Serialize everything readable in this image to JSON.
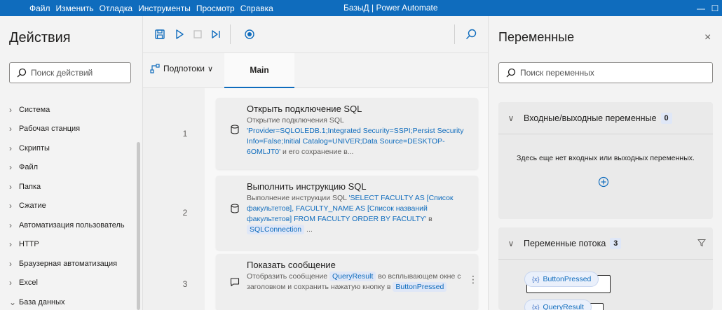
{
  "menu": {
    "items": [
      "Файл",
      "Изменить",
      "Отладка",
      "Инструменты",
      "Просмотр",
      "Справка"
    ],
    "window_title": "БазыД | Power Automate"
  },
  "actions_panel": {
    "title": "Действия",
    "search_placeholder": "Поиск действий",
    "categories": [
      "Система",
      "Рабочая станция",
      "Скрипты",
      "Файл",
      "Папка",
      "Сжатие",
      "Автоматизация пользователь",
      "HTTP",
      "Браузерная автоматизация",
      "Excel",
      "База данных"
    ]
  },
  "canvas": {
    "subflows_label": "Подпотоки",
    "main_tab": "Main",
    "steps": [
      {
        "number": "1",
        "title": "Открыть подключение SQL",
        "desc_prefix": "Открытие подключения SQL",
        "desc_link": "'Provider=SQLOLEDB.1;Integrated Security=SSPI;Persist Security Info=False;Initial Catalog=UNIVER;Data Source=DESKTOP-6OMLJT0'",
        "desc_suffix": " и его сохранение в..."
      },
      {
        "number": "2",
        "title": "Выполнить инструкцию SQL",
        "desc_prefix": "Выполнение инструкции SQL ",
        "desc_link": "'SELECT FACULTY AS [Список факультетов], FACULTY_NAME AS [Список названий факультетов] FROM FACULTY ORDER BY FACULTY'",
        "desc_mid": " в ",
        "desc_pill": "SQLConnection",
        "desc_suffix": " ..."
      },
      {
        "number": "3",
        "title": "Показать сообщение",
        "desc_prefix": "Отобразить сообщение ",
        "desc_pill": "QueryResult",
        "desc_mid": " во всплывающем окне с заголовком  и сохранить нажатую кнопку в ",
        "desc_pill2": "ButtonPressed"
      }
    ]
  },
  "variables_panel": {
    "title": "Переменные",
    "close_icon": "×",
    "search_placeholder": "Поиск переменных",
    "io_section": {
      "label": "Входные/выходные переменные",
      "count": "0",
      "empty_text": "Здесь еще нет входных или выходных переменных."
    },
    "flow_section": {
      "label": "Переменные потока",
      "count": "3",
      "variables": [
        "ButtonPressed",
        "QueryResult"
      ]
    }
  },
  "colors": {
    "accent": "#0f6cbd",
    "title_bar": "#0f6cbd",
    "background": "#f3f3f3",
    "pill_bg": "#dfe7f7"
  }
}
